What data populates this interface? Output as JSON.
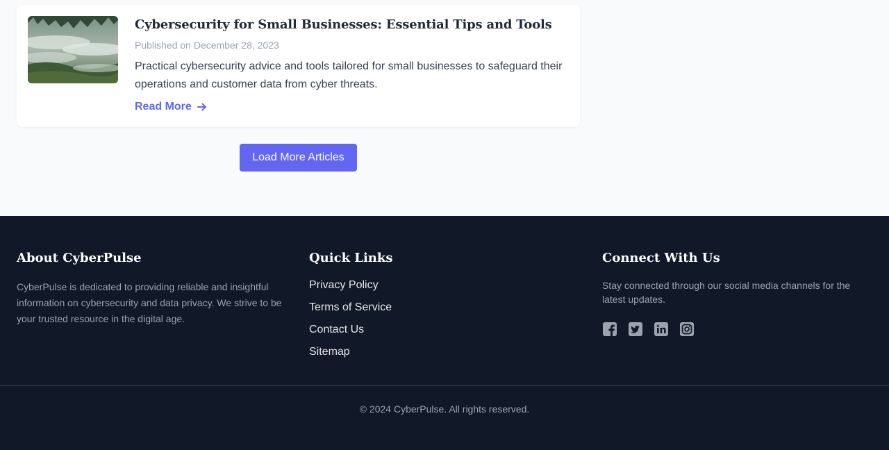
{
  "article": {
    "title": "Cybersecurity for Small Businesses: Essential Tips and Tools",
    "date": "Published on December 28, 2023",
    "excerpt": "Practical cybersecurity advice and tools tailored for small businesses to safeguard their operations and customer data from cyber threats.",
    "read_more": "Read More",
    "image_icon": "misty-forest-landscape"
  },
  "load_more": "Load More Articles",
  "footer": {
    "about": {
      "heading": "About CyberPulse",
      "text": "CyberPulse is dedicated to providing reliable and insightful information on cybersecurity and data privacy. We strive to be your trusted resource in the digital age."
    },
    "quick_links": {
      "heading": "Quick Links",
      "items": [
        "Privacy Policy",
        "Terms of Service",
        "Contact Us",
        "Sitemap"
      ]
    },
    "connect": {
      "heading": "Connect With Us",
      "text": "Stay connected through our social media channels for the latest updates.",
      "socials": [
        "facebook-icon",
        "twitter-icon",
        "linkedin-icon",
        "instagram-icon"
      ]
    },
    "copyright": "© 2024 CyberPulse. All rights reserved."
  },
  "colors": {
    "accent": "#6366f1",
    "footer_bg": "#111827",
    "page_bg": "#f9fafb"
  }
}
